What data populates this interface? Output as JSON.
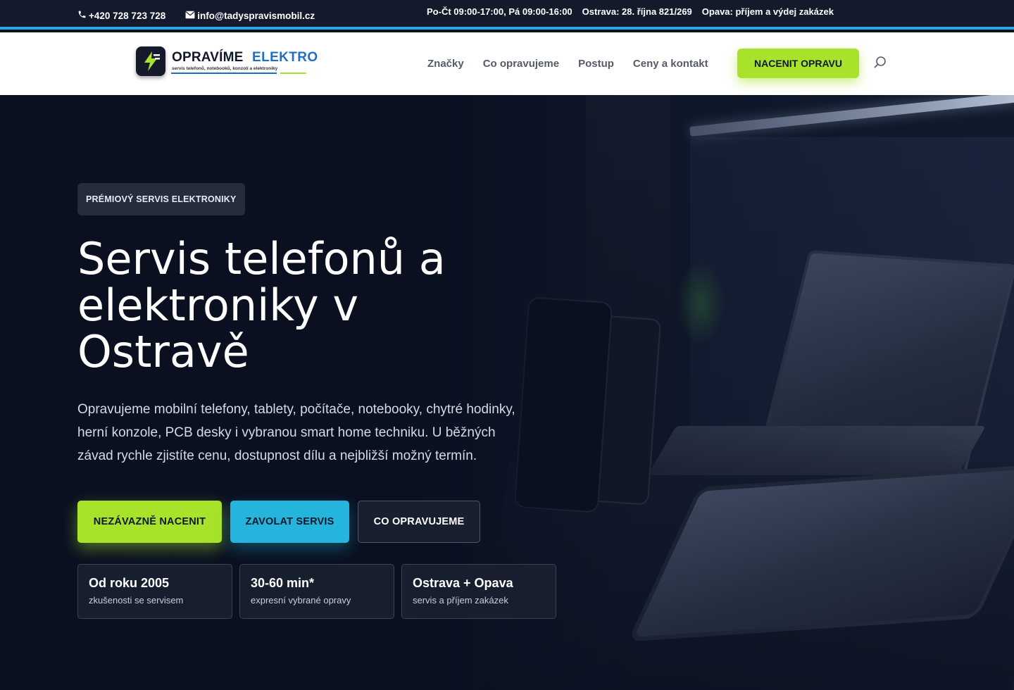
{
  "topbar": {
    "phone": "+420 728 723 728",
    "email": "info@tadyspravismobil.cz",
    "hours": "Po-Čt 09:00-17:00, Pá 09:00-16:00",
    "address_ostrava": "Ostrava: 28. října 821/269",
    "address_opava": "Opava: příjem a výdej zakázek"
  },
  "logo": {
    "word1": "OPRAVÍME",
    "word2": "ELEKTRO",
    "tagline": "servis telefonů, notebooků, konzolí a elektroniky"
  },
  "nav": {
    "items": [
      "Značky",
      "Co opravujeme",
      "Postup",
      "Ceny a kontakt"
    ],
    "cta": "NACENIT OPRAVU"
  },
  "hero": {
    "badge": "PRÉMIOVÝ SERVIS ELEKTRONIKY",
    "title": "Servis telefonů a elektroniky v Ostravě",
    "text": "Opravujeme mobilní telefony, tablety, počítače, notebooky, chytré hodinky, herní konzole, PCB desky i vybranou smart home techniku. U běžných závad rychle zjistíte cenu, dostupnost dílu a nejbližší možný termín.",
    "buttons": {
      "primary": "NEZÁVAZNĚ NACENIT",
      "call": "ZAVOLAT SERVIS",
      "what": "CO OPRAVUJEME"
    },
    "stats": [
      {
        "title": "Od roku 2005",
        "sub": "zkušenosti se servisem"
      },
      {
        "title": "30-60 min*",
        "sub": "expresní vybrané opravy"
      },
      {
        "title": "Ostrava + Opava",
        "sub": "servis a příjem zakázek"
      }
    ]
  },
  "colors": {
    "accent_green": "#a8e22a",
    "accent_blue": "#25b5dc",
    "brand_blue": "#1e6fc9",
    "dark": "#0b1222"
  }
}
